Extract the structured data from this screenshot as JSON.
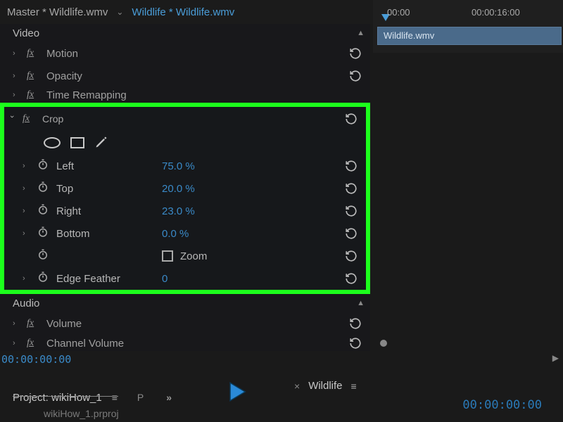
{
  "header": {
    "master_clip": "Master * Wildlife.wmv",
    "active_clip": "Wildlife * Wildlife.wmv"
  },
  "timeline": {
    "tick1": "00:00",
    "tick2": "00:00:16:00",
    "clip_name": "Wildlife.wmv"
  },
  "sections": {
    "video": "Video",
    "audio": "Audio"
  },
  "effects": {
    "motion": "Motion",
    "opacity": "Opacity",
    "time_remapping": "Time Remapping",
    "crop": "Crop",
    "volume": "Volume",
    "channel_volume": "Channel Volume"
  },
  "crop_params": {
    "left": {
      "label": "Left",
      "value": "75.0 %"
    },
    "top": {
      "label": "Top",
      "value": "20.0 %"
    },
    "right": {
      "label": "Right",
      "value": "23.0 %"
    },
    "bottom": {
      "label": "Bottom",
      "value": "0.0 %"
    },
    "zoom": "Zoom",
    "edge_feather": {
      "label": "Edge Feather",
      "value": "0"
    }
  },
  "timecode": "00:00:00:00",
  "project_panel": {
    "title": "Project: wikiHow_1",
    "letter": "P",
    "file": "wikiHow_1.prproj"
  },
  "source_panel": {
    "title": "Wildlife",
    "timecode": "00:00:00:00"
  }
}
